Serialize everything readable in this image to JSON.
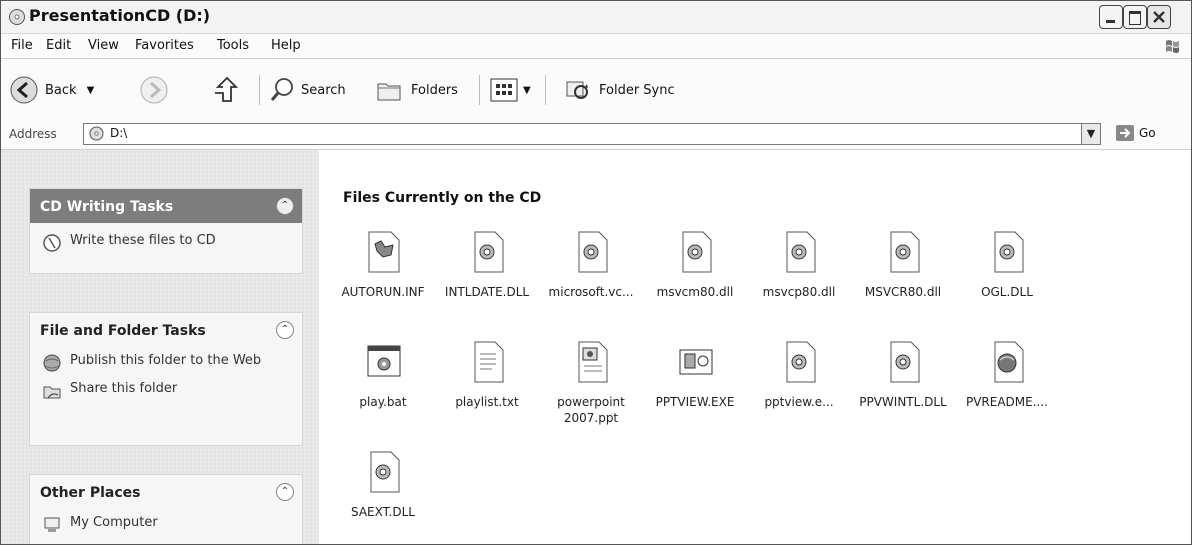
{
  "window": {
    "title": "PresentationCD (D:)"
  },
  "menu": [
    "File",
    "Edit",
    "View",
    "Favorites",
    "Tools",
    "Help"
  ],
  "toolbar": {
    "back": "Back",
    "search": "Search",
    "folders": "Folders",
    "folder_sync": "Folder Sync"
  },
  "address": {
    "label": "Address",
    "value": "D:\\",
    "go": "Go"
  },
  "sidebar": {
    "cd_tasks": {
      "title": "CD Writing Tasks",
      "items": [
        "Write these files to CD"
      ]
    },
    "file_folder_tasks": {
      "title": "File and Folder Tasks",
      "items": [
        "Publish this folder to the Web",
        "Share this folder"
      ]
    },
    "other_places": {
      "title": "Other Places",
      "items": [
        "My Computer"
      ]
    }
  },
  "content": {
    "heading": "Files Currently on the CD",
    "files": [
      {
        "name": "AUTORUN.INF",
        "icon": "setup-file-icon"
      },
      {
        "name": "INTLDATE.DLL",
        "icon": "dll-file-icon"
      },
      {
        "name": "microsoft.vc...",
        "icon": "dll-file-icon"
      },
      {
        "name": "msvcm80.dll",
        "icon": "dll-file-icon"
      },
      {
        "name": "msvcp80.dll",
        "icon": "dll-file-icon"
      },
      {
        "name": "MSVCR80.dll",
        "icon": "dll-file-icon"
      },
      {
        "name": "OGL.DLL",
        "icon": "dll-file-icon"
      },
      {
        "name": "play.bat",
        "icon": "batch-file-icon"
      },
      {
        "name": "playlist.txt",
        "icon": "text-file-icon"
      },
      {
        "name": "powerpoint 2007.ppt",
        "icon": "presentation-file-icon"
      },
      {
        "name": "PPTVIEW.EXE",
        "icon": "exe-file-icon"
      },
      {
        "name": "pptview.e...",
        "icon": "dll-file-icon"
      },
      {
        "name": "PPVWINTL.DLL",
        "icon": "dll-file-icon"
      },
      {
        "name": "PVREADME....",
        "icon": "html-file-icon"
      },
      {
        "name": "SAEXT.DLL",
        "icon": "dll-file-icon"
      }
    ]
  }
}
